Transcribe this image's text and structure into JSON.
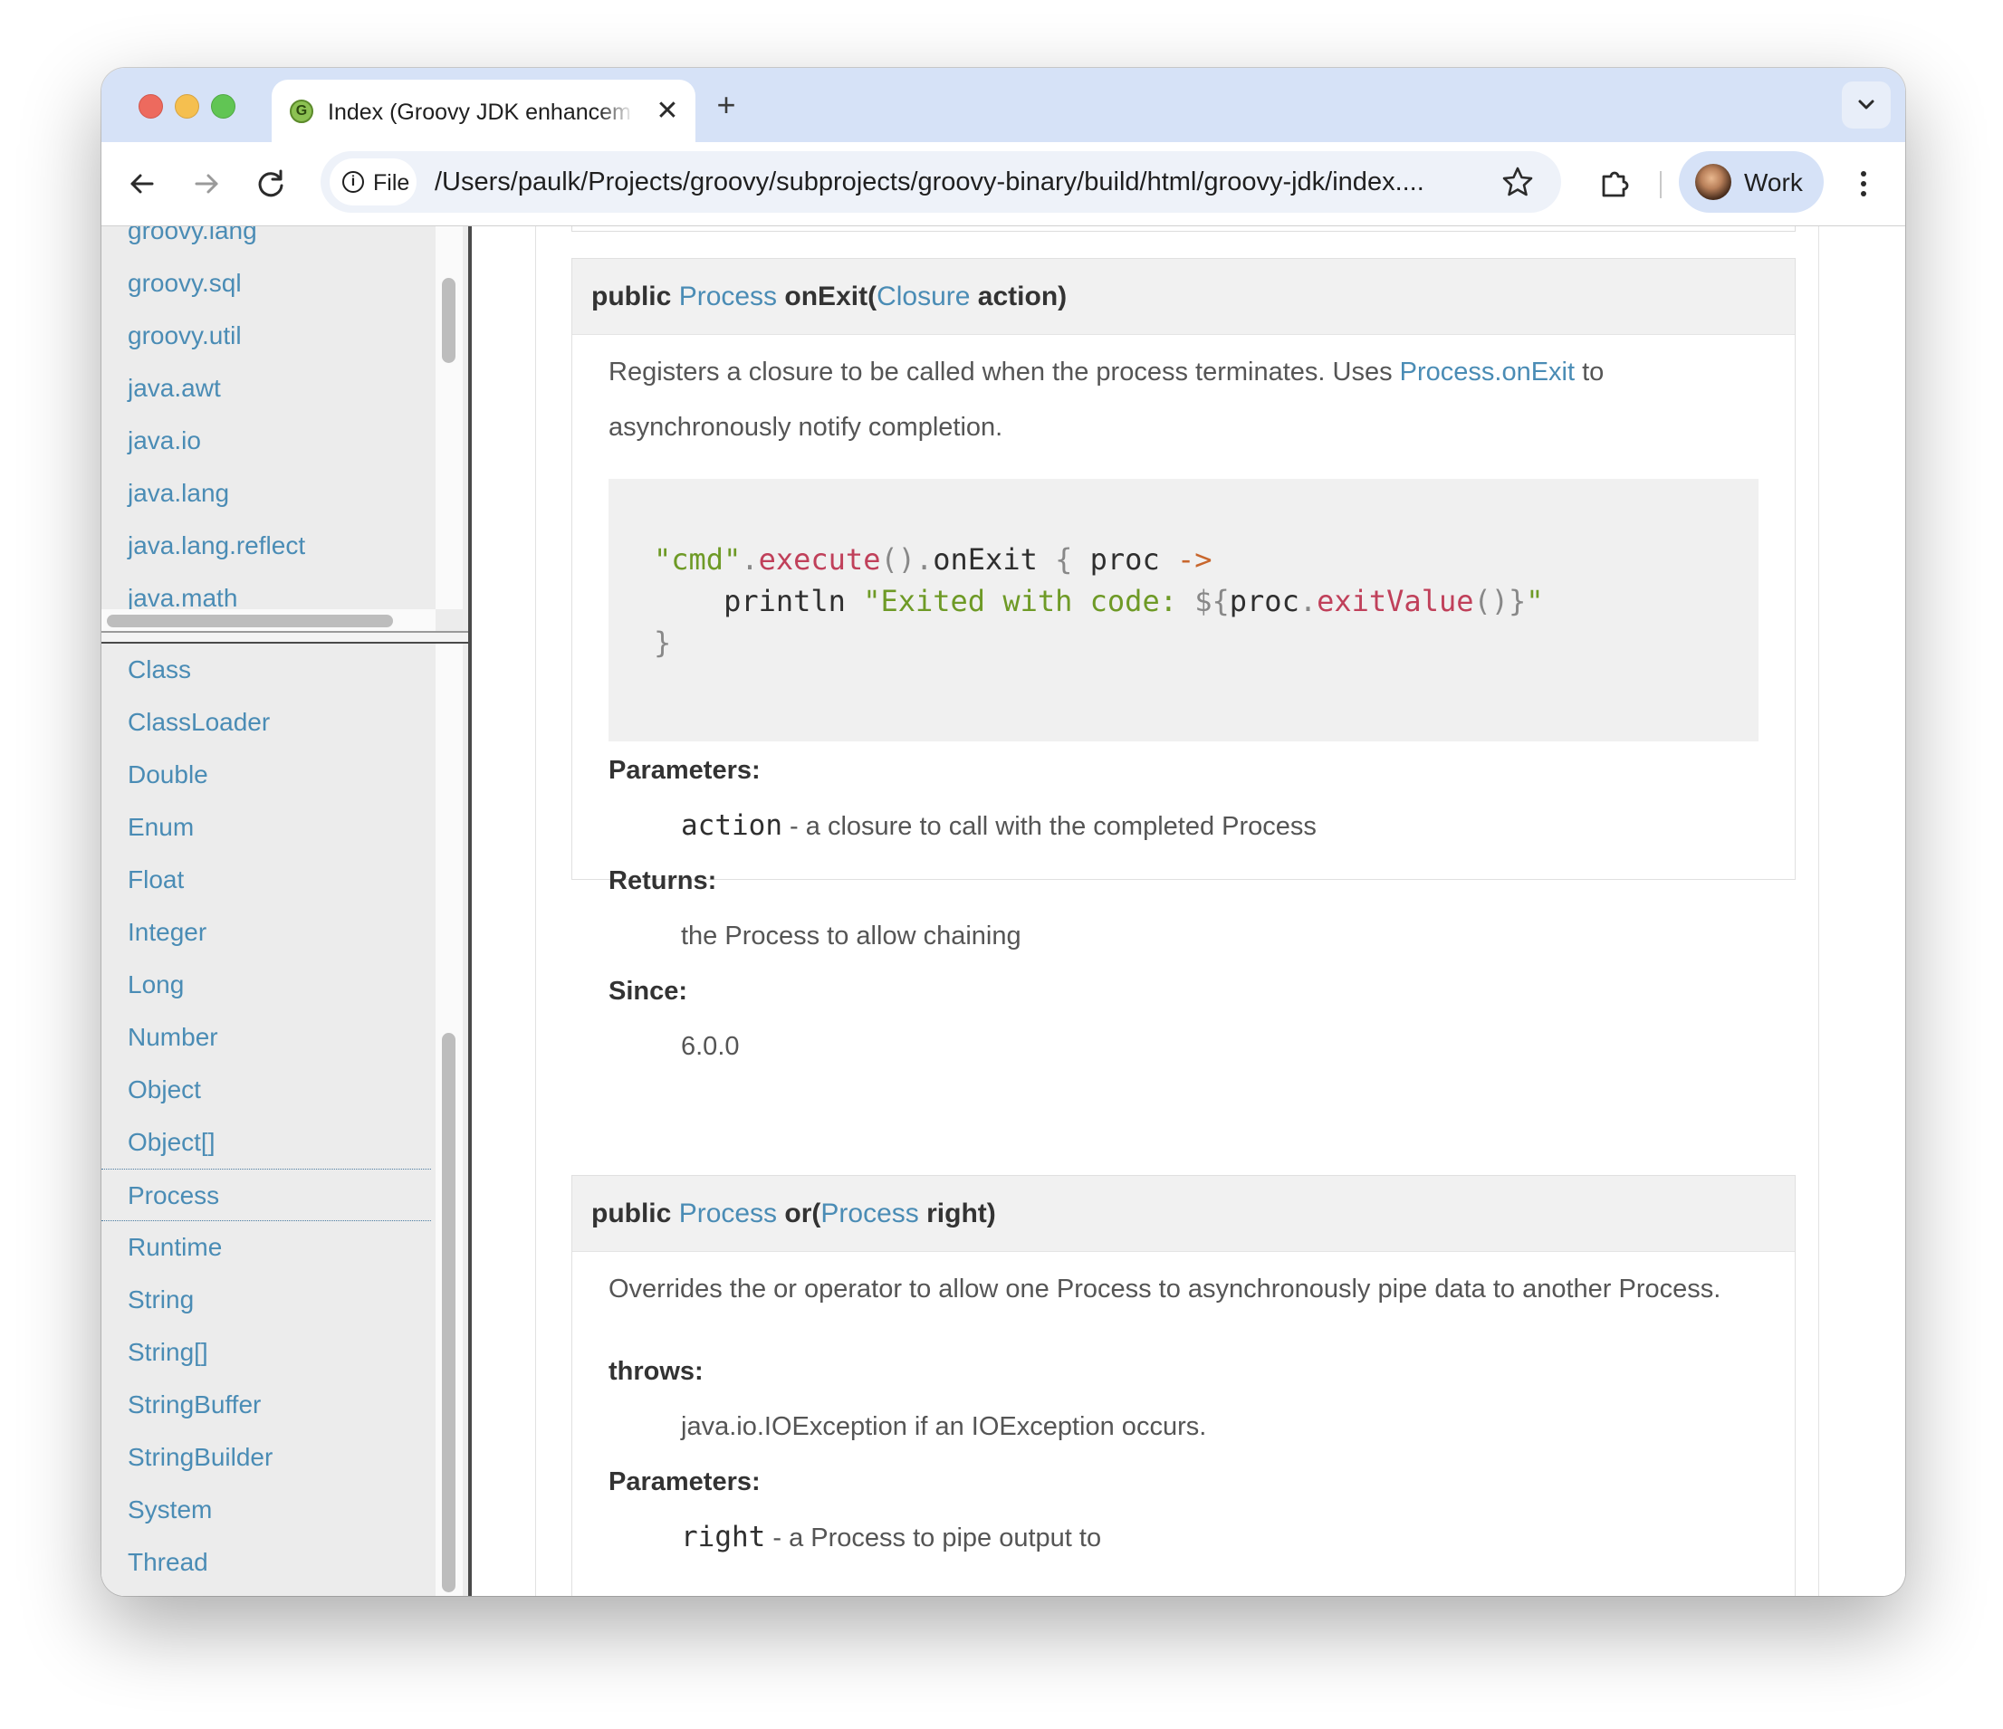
{
  "browser": {
    "tab": {
      "title": "Index (Groovy JDK enhancements)",
      "favicon": "groovy-favicon",
      "close_glyph": "✕"
    },
    "new_tab_glyph": "+",
    "toolbar": {
      "back_icon": "back-arrow-icon",
      "forward_icon": "forward-arrow-icon",
      "reload_icon": "reload-icon",
      "site_chip": "File",
      "url": "/Users/paulk/Projects/groovy/subprojects/groovy-binary/build/html/groovy-jdk/index....",
      "profile_label": "Work"
    }
  },
  "sidebar": {
    "packages": [
      "groovy.lang",
      "groovy.sql",
      "groovy.util",
      "java.awt",
      "java.io",
      "java.lang",
      "java.lang.reflect",
      "java.math"
    ],
    "classes": [
      "Class",
      "ClassLoader",
      "Double",
      "Enum",
      "Float",
      "Integer",
      "Long",
      "Number",
      "Object",
      "Object[]",
      "Process",
      "Runtime",
      "String",
      "String[]",
      "StringBuffer",
      "StringBuilder",
      "System",
      "Thread"
    ],
    "active_class": "Process"
  },
  "methods": [
    {
      "header": {
        "modifier": "public",
        "return_type": "Process",
        "name": "onExit(",
        "param_type": "Closure",
        "param_rest": "action)"
      },
      "description": {
        "before_link": "Registers a closure to be called when the process terminates. Uses ",
        "link": "Process.onExit",
        "after_link": " to asynchronously notify completion."
      },
      "code": {
        "l1_str": "\"cmd\"",
        "l1_dot1": ".",
        "l1_meth": "execute",
        "l1_paren": "()",
        "l1_dot2": ".",
        "l1_name": "onExit",
        "l1_brace": " { ",
        "l1_param": "proc",
        "l1_arrow": " ->",
        "l2_indent": "    ",
        "l2_call": "println",
        "l2_str": " \"Exited with code: ",
        "l2_interp_open": "${",
        "l2_var": "proc",
        "l2_dot": ".",
        "l2_meth": "exitValue",
        "l2_paren": "()",
        "l2_interp_close": "}",
        "l2_str_end": "\"",
        "l3": "}"
      },
      "parameters_label": "Parameters:",
      "param_name": "action",
      "param_desc": " - a closure to call with the completed Process",
      "returns_label": "Returns:",
      "returns_desc": "the Process to allow chaining",
      "since_label": "Since:",
      "since_value": "6.0.0"
    },
    {
      "header": {
        "modifier": "public",
        "return_type": "Process",
        "name": "or(",
        "param_type": "Process",
        "param_rest": "right)"
      },
      "description": "Overrides the or operator to allow one Process to asynchronously pipe data to another Process.",
      "throws_label": "throws:",
      "throws_desc": "java.io.IOException if an IOException occurs.",
      "parameters_label": "Parameters:",
      "param_name": "right",
      "param_desc": " - a Process to pipe output to"
    }
  ]
}
